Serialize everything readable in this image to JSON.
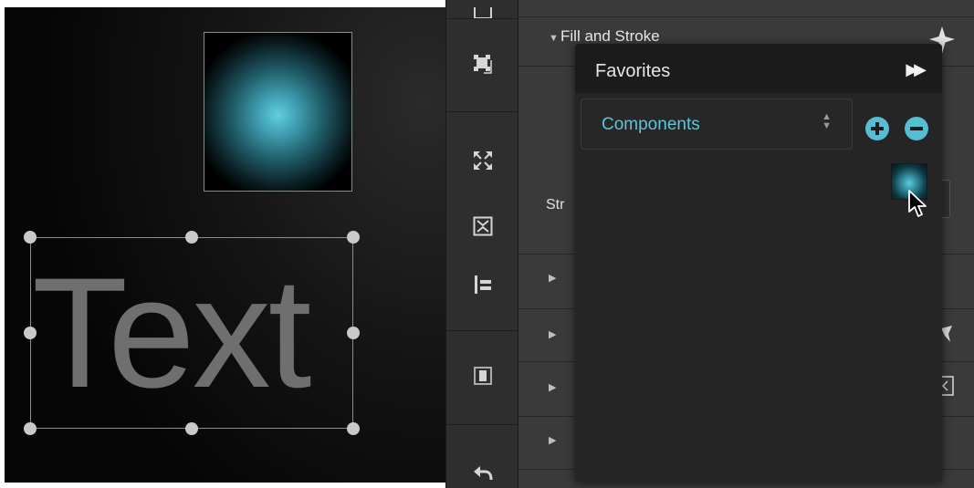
{
  "canvas": {
    "text_object": "Text"
  },
  "panel": {
    "fill_stroke_label": "Fill and Stroke",
    "stroke_label_partial": "Str"
  },
  "favorites": {
    "title": "Favorites",
    "library_select_value": "Components"
  },
  "icons": {
    "toolbar": [
      "frame-icon",
      "group-icon",
      "expand-icon",
      "fit-icon",
      "align-left-icon",
      "distribute-icon",
      "undo-icon"
    ],
    "panel_right": [
      "favorite-star-icon"
    ],
    "favorites": [
      "forward-icon",
      "select-arrows-icon",
      "add-icon",
      "remove-icon"
    ]
  },
  "colors": {
    "accent": "#56bdd2",
    "canvas_bg": "#0b0b0b",
    "panel_bg": "#3a3a3a",
    "popup_bg": "#252525"
  }
}
